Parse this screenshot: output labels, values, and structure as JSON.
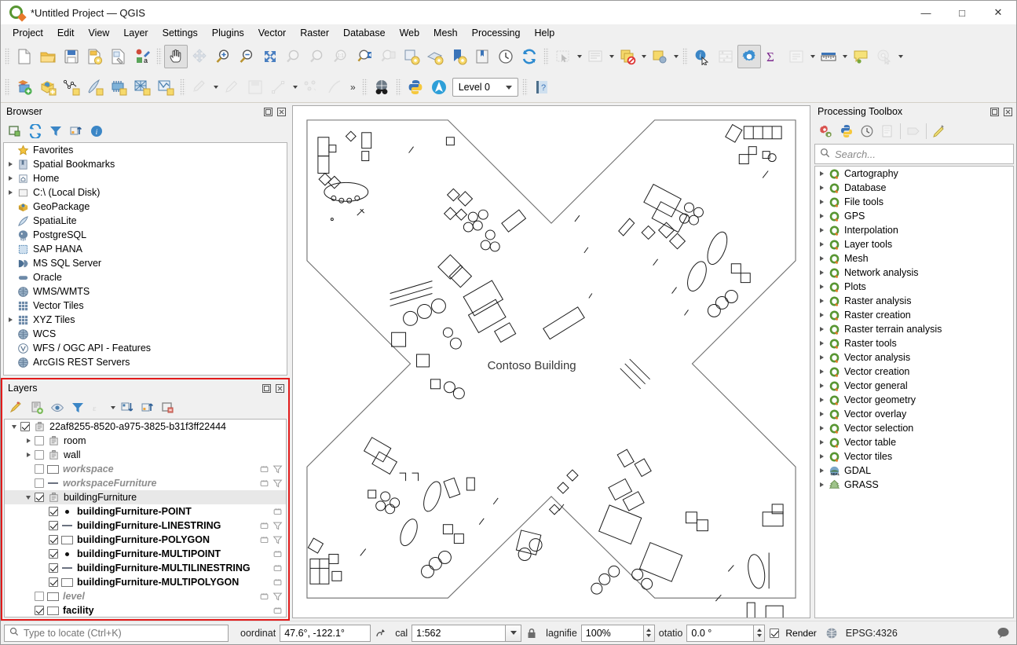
{
  "window": {
    "title": "*Untitled Project — QGIS",
    "minimize": "—",
    "maximize": "□",
    "close": "✕"
  },
  "menubar": [
    {
      "label": "Project"
    },
    {
      "label": "Edit"
    },
    {
      "label": "View"
    },
    {
      "label": "Layer"
    },
    {
      "label": "Settings"
    },
    {
      "label": "Plugins"
    },
    {
      "label": "Vector"
    },
    {
      "label": "Raster"
    },
    {
      "label": "Database"
    },
    {
      "label": "Web"
    },
    {
      "label": "Mesh"
    },
    {
      "label": "Processing"
    },
    {
      "label": "Help"
    }
  ],
  "toolbar_level": {
    "value": "Level 0"
  },
  "browser": {
    "title": "Browser",
    "items": [
      {
        "label": "Favorites",
        "icon": "star-icon",
        "expand": "none"
      },
      {
        "label": "Spatial Bookmarks",
        "icon": "bookmark-icon",
        "expand": "collapsed"
      },
      {
        "label": "Home",
        "icon": "home-icon",
        "expand": "collapsed"
      },
      {
        "label": "C:\\ (Local Disk)",
        "icon": "folder-icon",
        "expand": "collapsed"
      },
      {
        "label": "GeoPackage",
        "icon": "geopackage-icon",
        "expand": "none"
      },
      {
        "label": "SpatiaLite",
        "icon": "spatialite-icon",
        "expand": "none"
      },
      {
        "label": "PostgreSQL",
        "icon": "postgresql-icon",
        "expand": "none"
      },
      {
        "label": "SAP HANA",
        "icon": "saphana-icon",
        "expand": "none"
      },
      {
        "label": "MS SQL Server",
        "icon": "mssql-icon",
        "expand": "none"
      },
      {
        "label": "Oracle",
        "icon": "oracle-icon",
        "expand": "none"
      },
      {
        "label": "WMS/WMTS",
        "icon": "globe-icon",
        "expand": "none"
      },
      {
        "label": "Vector Tiles",
        "icon": "grid-icon",
        "expand": "none"
      },
      {
        "label": "XYZ Tiles",
        "icon": "grid-icon",
        "expand": "collapsed"
      },
      {
        "label": "WCS",
        "icon": "globe-icon",
        "expand": "none"
      },
      {
        "label": "WFS / OGC API - Features",
        "icon": "wfs-icon",
        "expand": "none"
      },
      {
        "label": "ArcGIS REST Servers",
        "icon": "globe-icon",
        "expand": "none"
      }
    ]
  },
  "layers": {
    "title": "Layers",
    "items": [
      {
        "label": "22af8255-8520-a975-3825-b31f3ff22444",
        "indent": 0,
        "expand": "expanded",
        "check": "on",
        "icon": "group-icon",
        "style": "normal",
        "symbol": "none",
        "end": []
      },
      {
        "label": "room",
        "indent": 1,
        "expand": "collapsed",
        "check": "off",
        "icon": "group-icon",
        "style": "normal",
        "symbol": "none",
        "end": []
      },
      {
        "label": "wall",
        "indent": 1,
        "expand": "collapsed",
        "check": "off",
        "icon": "group-icon",
        "style": "normal",
        "symbol": "none",
        "end": []
      },
      {
        "label": "workspace",
        "indent": 1,
        "expand": "none",
        "check": "off",
        "icon": "none",
        "style": "italic-gray",
        "symbol": "box",
        "end": [
          "memory-icon",
          "filter-icon"
        ]
      },
      {
        "label": "workspaceFurniture",
        "indent": 1,
        "expand": "none",
        "check": "off",
        "icon": "none",
        "style": "italic-gray",
        "symbol": "line",
        "end": [
          "memory-icon",
          "filter-icon"
        ]
      },
      {
        "label": "buildingFurniture",
        "indent": 1,
        "expand": "expanded",
        "check": "on",
        "icon": "group-icon",
        "style": "normal",
        "symbol": "none",
        "end": []
      },
      {
        "label": "buildingFurniture-POINT",
        "indent": 2,
        "expand": "none",
        "check": "on",
        "icon": "none",
        "style": "bold",
        "symbol": "pt",
        "end": [
          "memory-icon"
        ]
      },
      {
        "label": "buildingFurniture-LINESTRING",
        "indent": 2,
        "expand": "none",
        "check": "on",
        "icon": "none",
        "style": "bold",
        "symbol": "line",
        "end": [
          "memory-icon",
          "filter-icon"
        ]
      },
      {
        "label": "buildingFurniture-POLYGON",
        "indent": 2,
        "expand": "none",
        "check": "on",
        "icon": "none",
        "style": "bold",
        "symbol": "box",
        "end": [
          "memory-icon",
          "filter-icon"
        ]
      },
      {
        "label": "buildingFurniture-MULTIPOINT",
        "indent": 2,
        "expand": "none",
        "check": "on",
        "icon": "none",
        "style": "bold",
        "symbol": "pt",
        "end": [
          "memory-icon"
        ]
      },
      {
        "label": "buildingFurniture-MULTILINESTRING",
        "indent": 2,
        "expand": "none",
        "check": "on",
        "icon": "none",
        "style": "bold",
        "symbol": "line",
        "end": [
          "memory-icon"
        ]
      },
      {
        "label": "buildingFurniture-MULTIPOLYGON",
        "indent": 2,
        "expand": "none",
        "check": "on",
        "icon": "none",
        "style": "bold",
        "symbol": "box",
        "end": [
          "memory-icon"
        ]
      },
      {
        "label": "level",
        "indent": 1,
        "expand": "none",
        "check": "off",
        "icon": "none",
        "style": "italic-gray",
        "symbol": "box",
        "end": [
          "memory-icon",
          "filter-icon"
        ]
      },
      {
        "label": "facility",
        "indent": 1,
        "expand": "none",
        "check": "on",
        "icon": "none",
        "style": "bold",
        "symbol": "box",
        "end": [
          "memory-icon"
        ]
      }
    ]
  },
  "processing": {
    "title": "Processing Toolbox",
    "search": {
      "placeholder": "Search...",
      "value": ""
    },
    "items": [
      {
        "label": "Cartography",
        "icon": "qgis-icon"
      },
      {
        "label": "Database",
        "icon": "qgis-icon"
      },
      {
        "label": "File tools",
        "icon": "qgis-icon"
      },
      {
        "label": "GPS",
        "icon": "qgis-icon"
      },
      {
        "label": "Interpolation",
        "icon": "qgis-icon"
      },
      {
        "label": "Layer tools",
        "icon": "qgis-icon"
      },
      {
        "label": "Mesh",
        "icon": "qgis-icon"
      },
      {
        "label": "Network analysis",
        "icon": "qgis-icon"
      },
      {
        "label": "Plots",
        "icon": "qgis-icon"
      },
      {
        "label": "Raster analysis",
        "icon": "qgis-icon"
      },
      {
        "label": "Raster creation",
        "icon": "qgis-icon"
      },
      {
        "label": "Raster terrain analysis",
        "icon": "qgis-icon"
      },
      {
        "label": "Raster tools",
        "icon": "qgis-icon"
      },
      {
        "label": "Vector analysis",
        "icon": "qgis-icon"
      },
      {
        "label": "Vector creation",
        "icon": "qgis-icon"
      },
      {
        "label": "Vector general",
        "icon": "qgis-icon"
      },
      {
        "label": "Vector geometry",
        "icon": "qgis-icon"
      },
      {
        "label": "Vector overlay",
        "icon": "qgis-icon"
      },
      {
        "label": "Vector selection",
        "icon": "qgis-icon"
      },
      {
        "label": "Vector table",
        "icon": "qgis-icon"
      },
      {
        "label": "Vector tiles",
        "icon": "qgis-icon"
      },
      {
        "label": "GDAL",
        "icon": "gdal-icon"
      },
      {
        "label": "GRASS",
        "icon": "grass-icon"
      }
    ]
  },
  "map": {
    "label": "Contoso Building"
  },
  "status": {
    "locate_placeholder": "Type to locate (Ctrl+K)",
    "coordinate_label": "oordinat",
    "coordinate_value": "47.6°, -122.1°",
    "scale_label": "cal",
    "scale_value": "1:562",
    "magnifier_label": "lagnifie",
    "magnifier_value": "100%",
    "rotation_label": "otatio",
    "rotation_value": "0.0 °",
    "render_label": "Render",
    "crs_value": "EPSG:4326"
  }
}
